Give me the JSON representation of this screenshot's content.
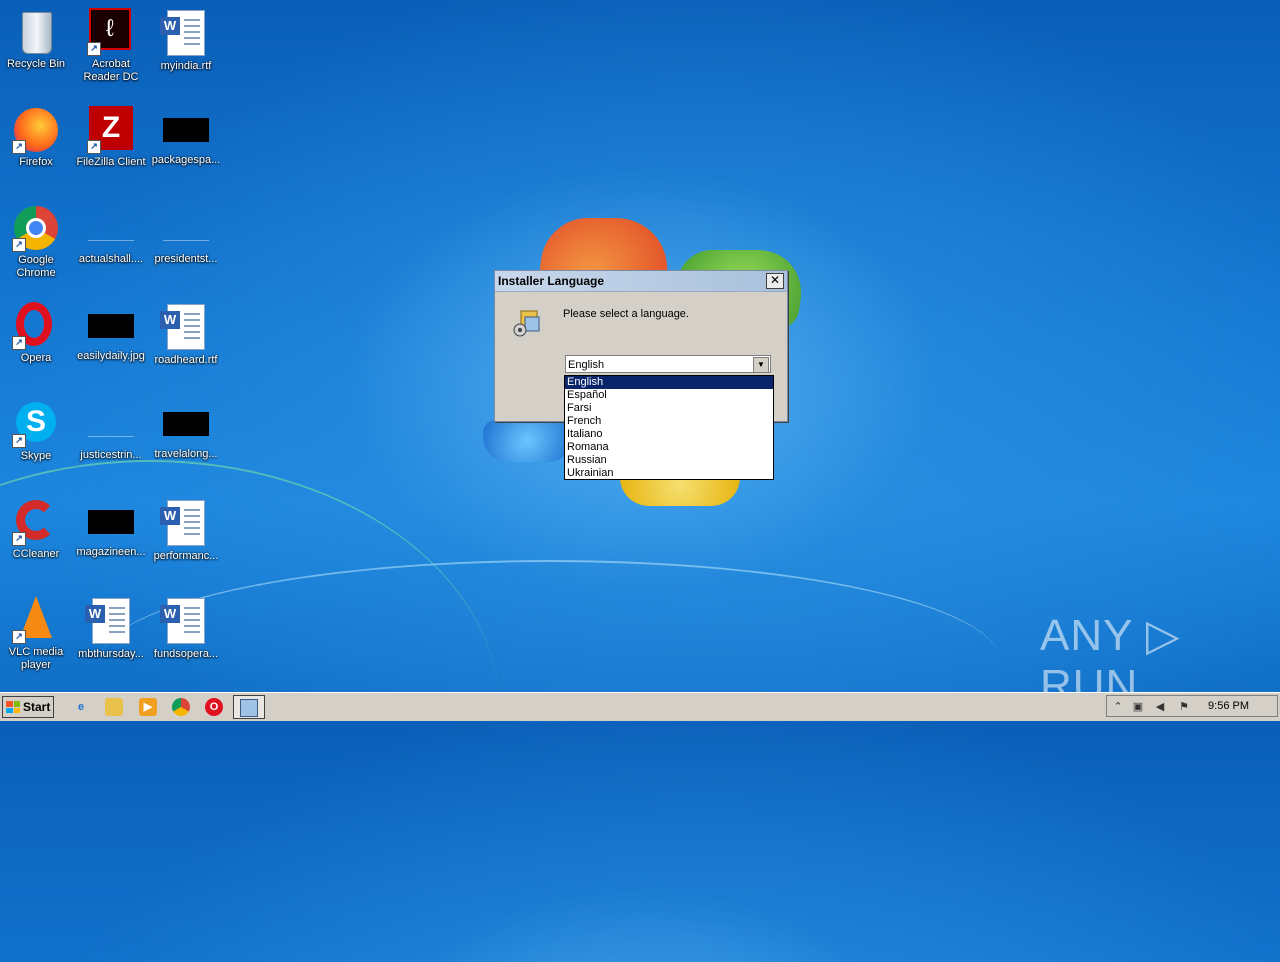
{
  "desktop": {
    "icons": [
      {
        "label": "Recycle Bin",
        "icon": "recycle-bin-icon"
      },
      {
        "label": "Acrobat Reader DC",
        "icon": "acrobat-icon"
      },
      {
        "label": "myindia.rtf",
        "icon": "word-document-icon"
      },
      {
        "label": "Firefox",
        "icon": "firefox-icon"
      },
      {
        "label": "FileZilla Client",
        "icon": "filezilla-icon"
      },
      {
        "label": "packagespa...",
        "icon": "file-thumbnail-icon"
      },
      {
        "label": "Google Chrome",
        "icon": "chrome-icon"
      },
      {
        "label": "actualshall....",
        "icon": "file-icon"
      },
      {
        "label": "presidentst...",
        "icon": "file-icon"
      },
      {
        "label": "Opera",
        "icon": "opera-icon"
      },
      {
        "label": "easilydaily.jpg",
        "icon": "image-thumbnail-icon"
      },
      {
        "label": "roadheard.rtf",
        "icon": "word-document-icon"
      },
      {
        "label": "Skype",
        "icon": "skype-icon"
      },
      {
        "label": "justicestrin...",
        "icon": "file-icon"
      },
      {
        "label": "travelalong...",
        "icon": "file-thumbnail-icon"
      },
      {
        "label": "CCleaner",
        "icon": "ccleaner-icon"
      },
      {
        "label": "magazineen...",
        "icon": "file-thumbnail-icon"
      },
      {
        "label": "performanc...",
        "icon": "word-document-icon"
      },
      {
        "label": "VLC media player",
        "icon": "vlc-icon"
      },
      {
        "label": "mbthursday...",
        "icon": "word-document-icon"
      },
      {
        "label": "fundsopera...",
        "icon": "word-document-icon"
      }
    ]
  },
  "dialog": {
    "title": "Installer Language",
    "close_label": "✕",
    "message": "Please select a language.",
    "selected_value": "English",
    "options": [
      "English",
      "Español",
      "Farsi",
      "French",
      "Italiano",
      "Romana",
      "Russian",
      "Ukrainian"
    ]
  },
  "taskbar": {
    "start_label": "Start",
    "clock": "9:56 PM"
  },
  "watermark": "ANY ▷ RUN"
}
